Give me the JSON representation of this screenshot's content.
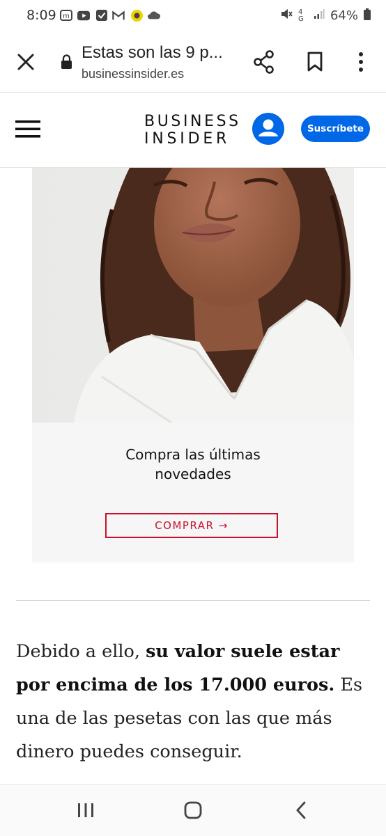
{
  "status_bar": {
    "time": "8:09",
    "notification_icons": [
      "m-app-icon",
      "youtube-icon",
      "check-icon",
      "gmail-icon",
      "snapchat-icon",
      "cloud-icon"
    ],
    "network": "4G",
    "battery": "64%"
  },
  "browser": {
    "page_title": "Estas son las 9 p...",
    "domain": "businessinsider.es"
  },
  "site_header": {
    "brand_line1": "BUSINESS",
    "brand_line2": "INSIDER",
    "subscribe_label": "Suscríbete",
    "accent_color": "#0067e6"
  },
  "ad": {
    "headline": "Compra las últimas novedades",
    "button_label": "COMPRAR →",
    "button_color": "#c8102e"
  },
  "article": {
    "seg1": "Debido a ello, ",
    "seg2_bold": "su valor suele estar por encima de los 17.000 euros.",
    "seg3": " Es una de las pesetas con las que más dinero puedes conseguir."
  }
}
